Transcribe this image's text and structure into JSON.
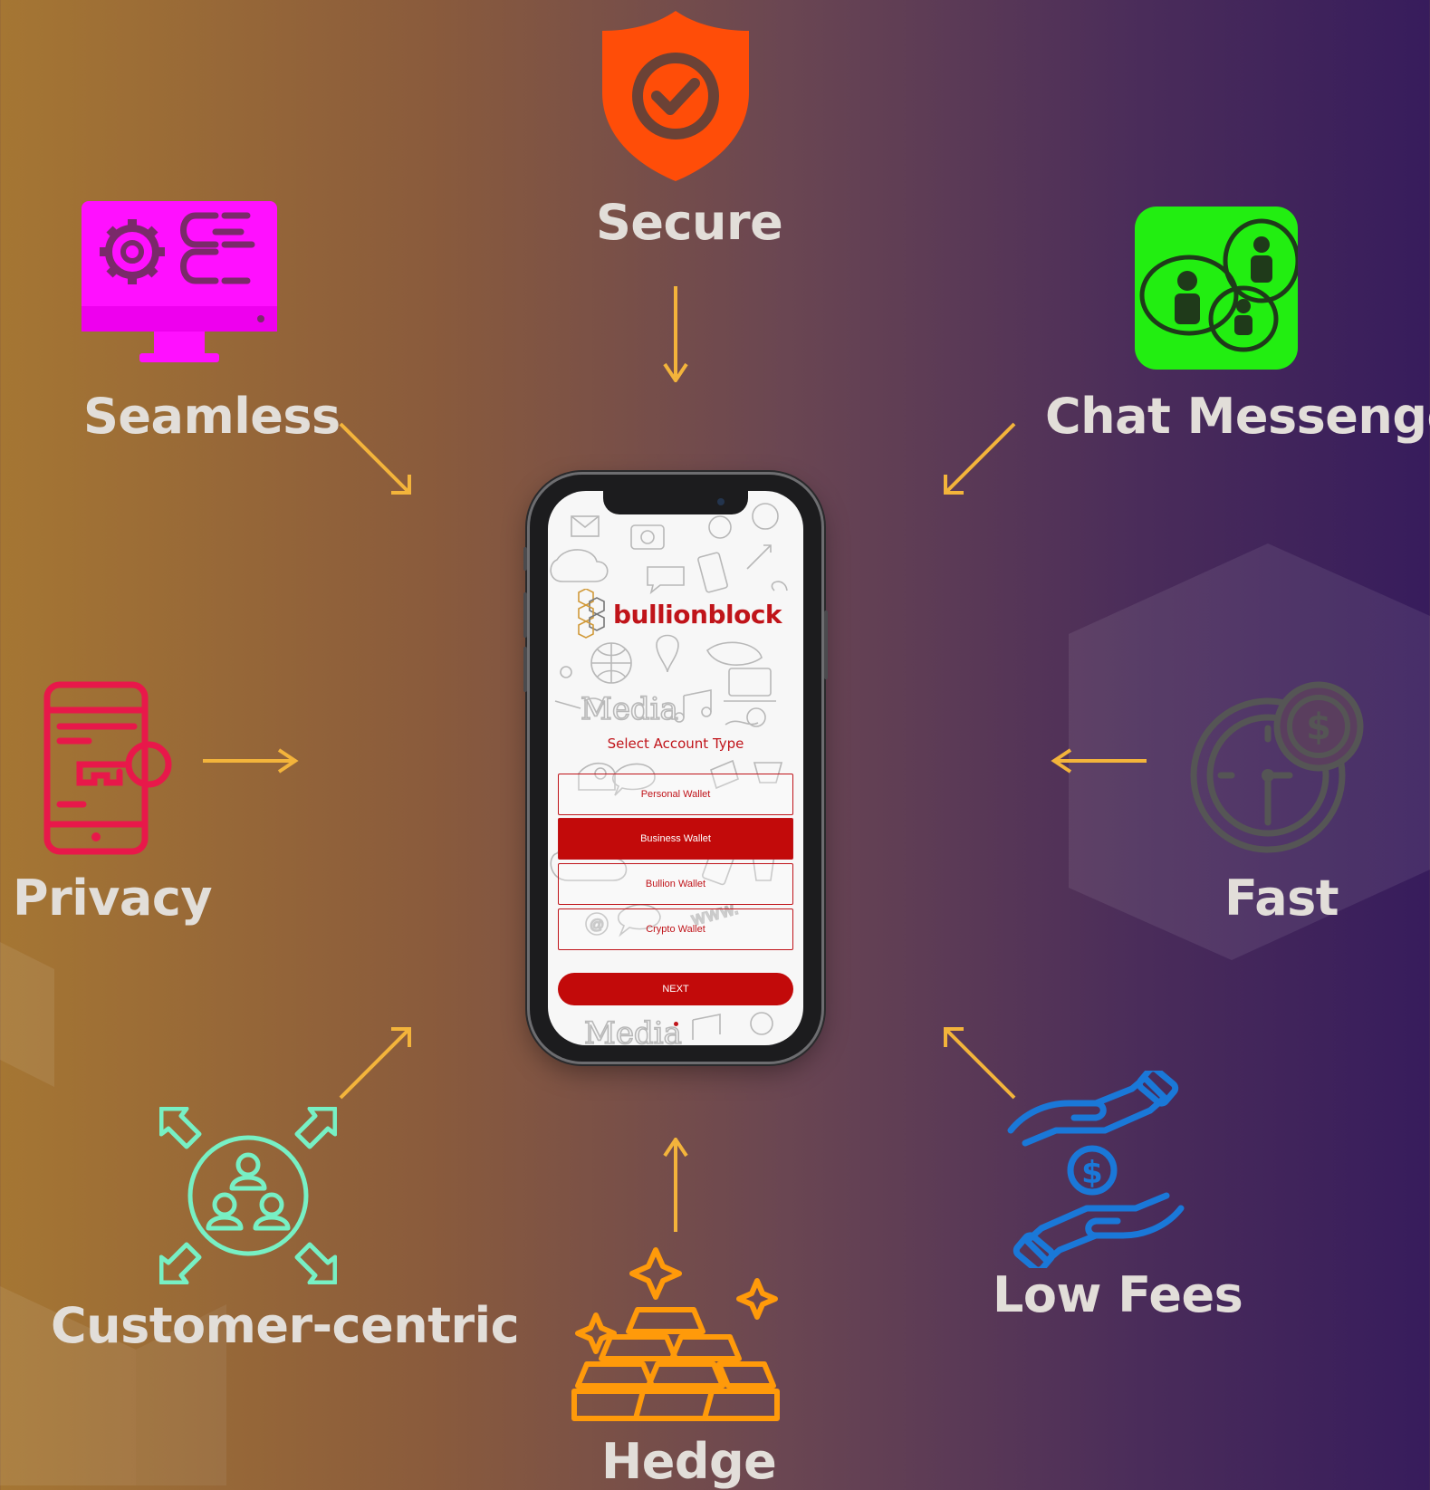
{
  "features": {
    "secure": "Secure",
    "seamless": "Seamless",
    "chat": "Chat Messenger",
    "privacy": "Privacy",
    "fast": "Fast",
    "customer": "Customer-centric",
    "lowfees": "Low Fees",
    "hedge": "Hedge"
  },
  "phone": {
    "brand": "bullionblock",
    "select_title": "Select Account Type",
    "options": [
      "Personal Wallet",
      "Business Wallet",
      "Bullion Wallet",
      "Crypto Wallet"
    ],
    "selected_option": "Business Wallet",
    "next_label": "NEXT"
  },
  "colors": {
    "arrow": "#f3b43b",
    "secure_icon": "#ff4d08",
    "seamless_icon": "#ff10ff",
    "chat_icon": "#22ee11",
    "privacy_icon": "#e8184a",
    "fast_icon": "#555555",
    "customer_icon": "#77f0c4",
    "lowfees_icon": "#1a78d8",
    "hedge_icon": "#ff9a0a",
    "brand_red": "#c20a0a"
  },
  "icons": [
    "shield-check-icon",
    "monitor-gear-icon",
    "chat-people-icon",
    "phone-key-icon",
    "clock-dollar-icon",
    "customer-focus-icon",
    "hands-dollar-icon",
    "gold-bars-icon"
  ]
}
